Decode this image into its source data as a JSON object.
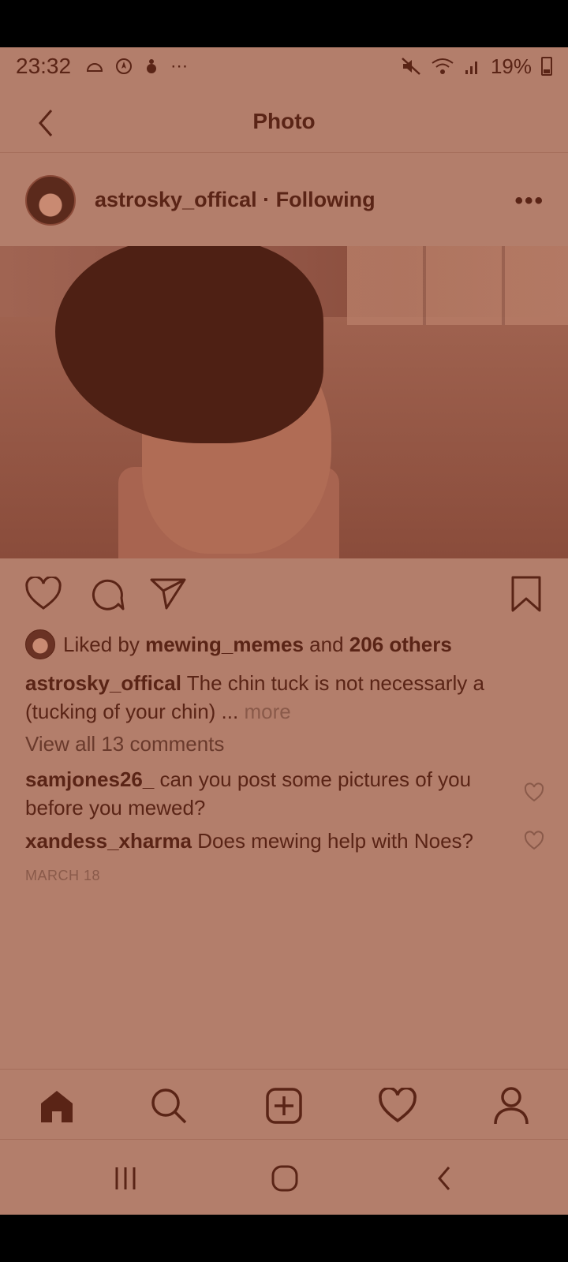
{
  "status_bar": {
    "time": "23:32",
    "battery": "19%",
    "more": "⋯"
  },
  "header": {
    "title": "Photo"
  },
  "post": {
    "username": "astrosky_offical",
    "follow_state": "Following",
    "separator": " · ",
    "more": "•••"
  },
  "likes": {
    "prefix": "Liked by ",
    "user": "mewing_memes",
    "middle": " and ",
    "count_text": "206 others"
  },
  "caption": {
    "username": "astrosky_offical",
    "text": " The chin tuck is not necessarly a (tucking of your chin) ... ",
    "more": "more"
  },
  "view_all_comments": "View all 13 comments",
  "comments": [
    {
      "username": "samjones26_",
      "text": " can you post some pictures of you before you mewed?"
    },
    {
      "username": "xandess_xharma",
      "text": " Does mewing help with Noes?"
    }
  ],
  "date": "MARCH 18",
  "colors": {
    "background": "#b37e6b",
    "text": "#5a2416",
    "muted": "#8a5a4a"
  }
}
